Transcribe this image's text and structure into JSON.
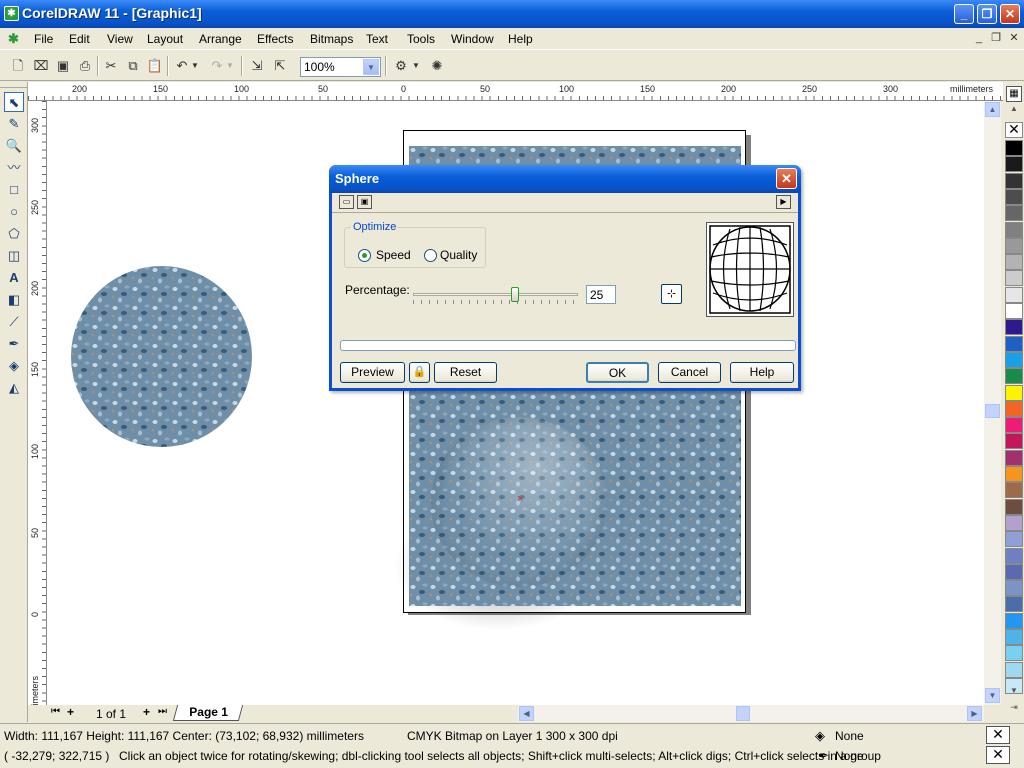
{
  "window": {
    "title": "CorelDRAW 11 - [Graphic1]",
    "min": "_",
    "max": "❐",
    "close": "✕"
  },
  "menu": [
    "File",
    "Edit",
    "View",
    "Layout",
    "Arrange",
    "Effects",
    "Bitmaps",
    "Text",
    "Tools",
    "Window",
    "Help"
  ],
  "toolbar": {
    "zoom": "100%"
  },
  "ruler": {
    "h_ticks": [
      "200",
      "150",
      "100",
      "50",
      "0",
      "50",
      "100",
      "150",
      "200",
      "250",
      "300"
    ],
    "h_unit": "millimeters",
    "v_ticks": [
      "300",
      "250",
      "200",
      "150",
      "100",
      "50",
      "0"
    ],
    "v_unit": "millimeters"
  },
  "pagebar": {
    "counter": "1 of 1",
    "tab": "Page 1"
  },
  "status": {
    "dimensions": "Width: 111,167  Height: 111,167  Center: (73,102; 68,932)  millimeters",
    "object": "CMYK Bitmap on Layer 1 300 x 300 dpi",
    "coords": "( -32,279; 322,715 )",
    "hint": "Click an object twice for rotating/skewing; dbl-clicking tool selects all objects; Shift+click multi-selects; Alt+click digs; Ctrl+click selects in a group",
    "fill": "None",
    "outline": "None"
  },
  "dialog": {
    "title": "Sphere",
    "optimize_label": "Optimize",
    "speed": "Speed",
    "quality": "Quality",
    "selected": "Speed",
    "percentage_label": "Percentage:",
    "percentage": "25",
    "buttons": {
      "preview": "Preview",
      "reset": "Reset",
      "ok": "OK",
      "cancel": "Cancel",
      "help": "Help"
    }
  },
  "palette": [
    "#ffffff",
    "#000000",
    "#1a1a1a",
    "#333333",
    "#4d4d4d",
    "#666666",
    "#808080",
    "#999999",
    "#b3b3b3",
    "#cccccc",
    "#e6e6e6",
    "#ffffff",
    "#2e1a8c",
    "#1e5fc8",
    "#1aa0e6",
    "#1a8c4a",
    "#fff200",
    "#f26522",
    "#ed1c74",
    "#c2185b",
    "#a0306e",
    "#f7941d",
    "#9e6b4a",
    "#6d4c41",
    "#b3a0cf",
    "#8fa0d6",
    "#6f7fc6",
    "#5a6ab0",
    "#7b94c8",
    "#4a6ea8",
    "#2196f3",
    "#4fb3e8",
    "#7ad0f0",
    "#a0d8ef",
    "#c8e8f8"
  ],
  "icons": {
    "app": "coreldraw-icon",
    "cursor": "pick-tool-icon"
  }
}
